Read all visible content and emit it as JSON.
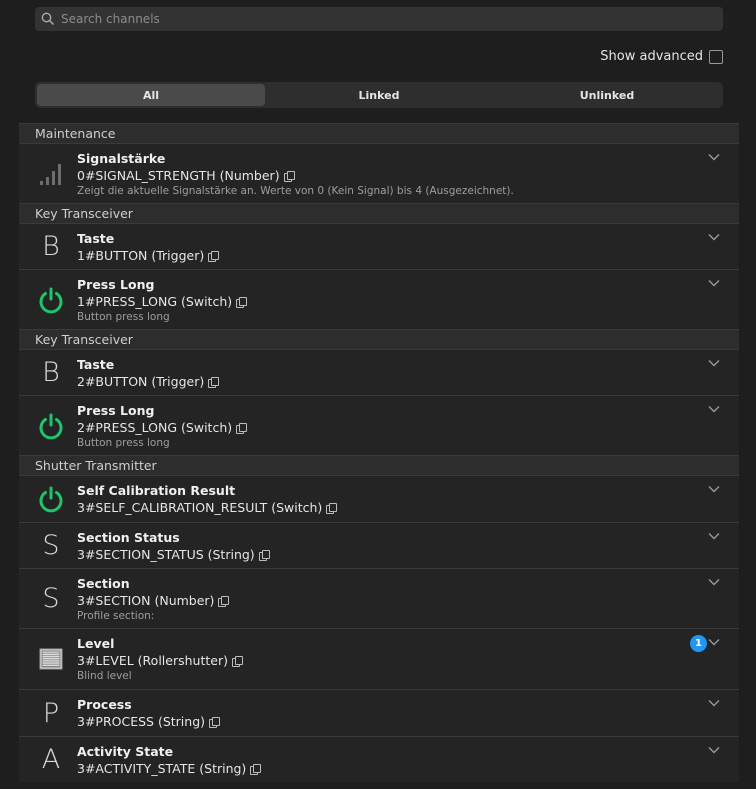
{
  "search": {
    "placeholder": "Search channels"
  },
  "show_advanced": {
    "label": "Show advanced",
    "checked": false
  },
  "filter_tabs": [
    {
      "label": "All",
      "active": true
    },
    {
      "label": "Linked",
      "active": false
    },
    {
      "label": "Unlinked",
      "active": false
    }
  ],
  "groups": [
    {
      "title": "Maintenance",
      "items": [
        {
          "icon": "signal-strength-icon",
          "title": "Signalstärke",
          "channel": "0#SIGNAL_STRENGTH (Number)",
          "description": "Zeigt die aktuelle Signalstärke an. Werte von 0 (Kein Signal) bis 4 (Ausgezeichnet)."
        }
      ]
    },
    {
      "title": "Key Transceiver",
      "items": [
        {
          "icon": "letter-b-icon",
          "letter": "B",
          "title": "Taste",
          "channel": "1#BUTTON (Trigger)"
        },
        {
          "icon": "power-icon",
          "title": "Press Long",
          "channel": "1#PRESS_LONG (Switch)",
          "description": "Button press long"
        }
      ]
    },
    {
      "title": "Key Transceiver",
      "items": [
        {
          "icon": "letter-b-icon",
          "letter": "B",
          "title": "Taste",
          "channel": "2#BUTTON (Trigger)"
        },
        {
          "icon": "power-icon",
          "title": "Press Long",
          "channel": "2#PRESS_LONG (Switch)",
          "description": "Button press long"
        }
      ]
    },
    {
      "title": "Shutter Transmitter",
      "items": [
        {
          "icon": "power-icon",
          "title": "Self Calibration Result",
          "channel": "3#SELF_CALIBRATION_RESULT (Switch)"
        },
        {
          "icon": "letter-s-icon",
          "letter": "S",
          "title": "Section Status",
          "channel": "3#SECTION_STATUS (String)"
        },
        {
          "icon": "letter-s-icon",
          "letter": "S",
          "title": "Section",
          "channel": "3#SECTION (Number)",
          "description": "Profile section:"
        },
        {
          "icon": "rollershutter-icon",
          "title": "Level",
          "channel": "3#LEVEL (Rollershutter)",
          "description": "Blind level",
          "badge": "1"
        },
        {
          "icon": "letter-p-icon",
          "letter": "P",
          "title": "Process",
          "channel": "3#PROCESS (String)"
        },
        {
          "icon": "letter-a-icon",
          "letter": "A",
          "title": "Activity State",
          "channel": "3#ACTIVITY_STATE (String)"
        }
      ]
    }
  ],
  "colors": {
    "accent_green": "#1fc46b",
    "badge_blue": "#2196f3"
  }
}
